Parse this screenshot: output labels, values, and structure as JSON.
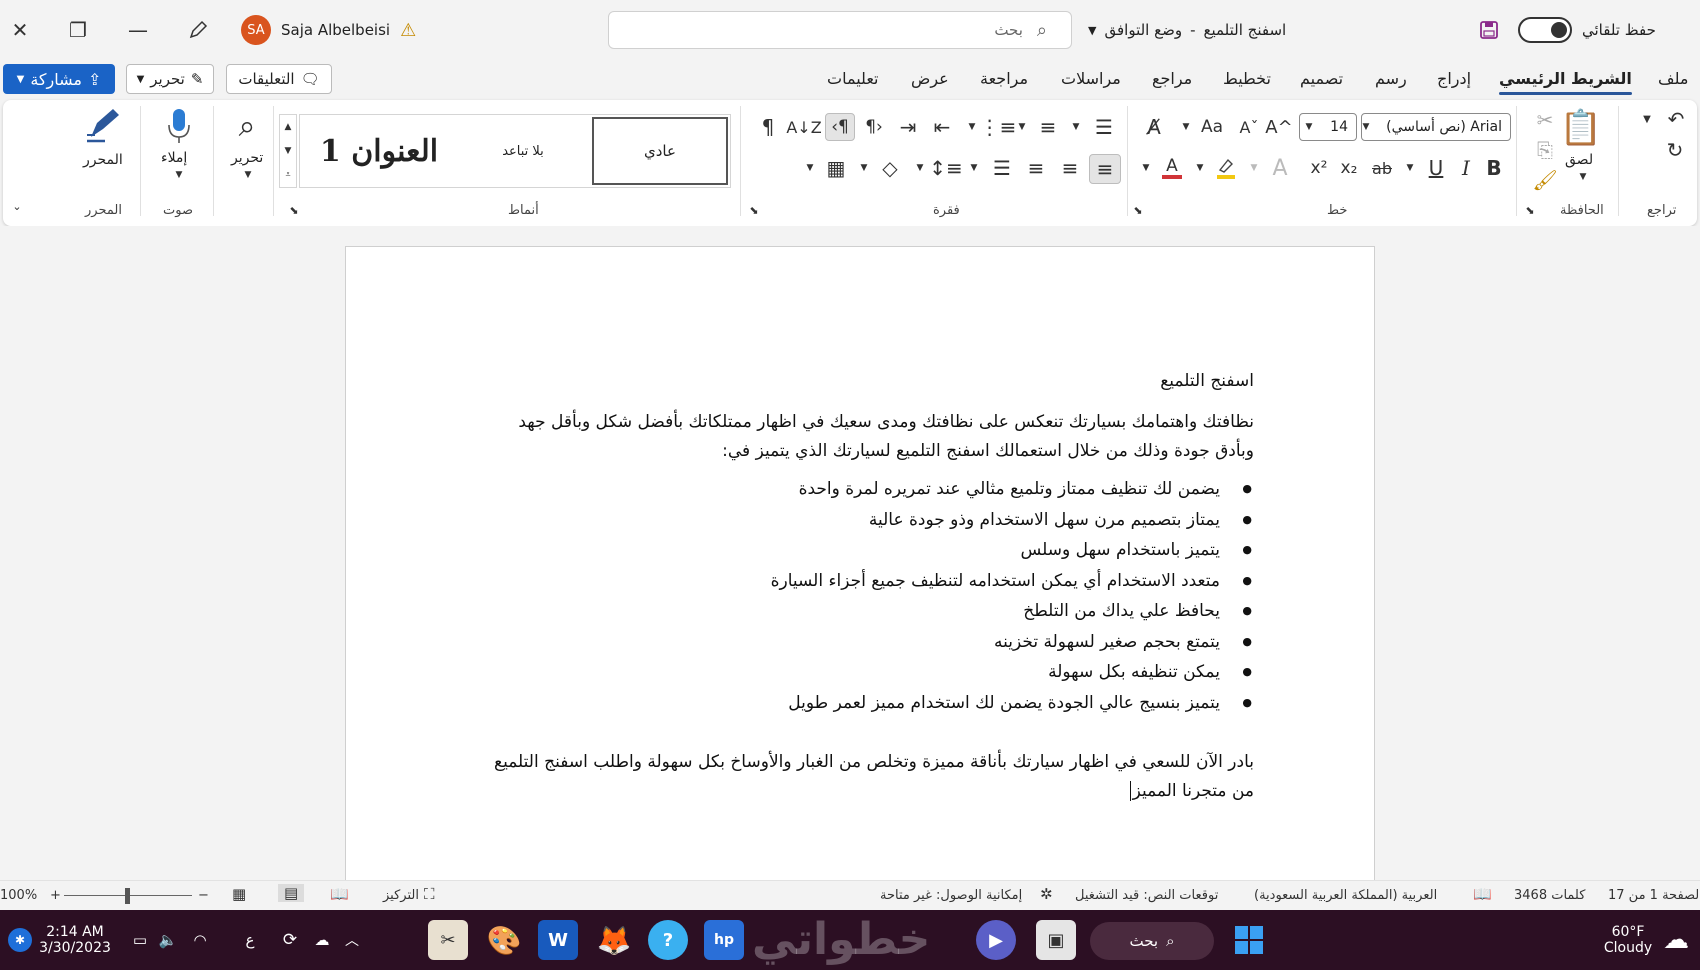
{
  "window": {
    "title": "اسفنج التلميع",
    "mode": "وضع التوافق",
    "title_separator": "-",
    "user_name": "Saja Albelbeisi",
    "user_initials": "SA",
    "autosave_label": "حفظ تلقائي",
    "search_placeholder": "بحث"
  },
  "ribbon_tabs": [
    "ملف",
    "الشريط الرئيسي",
    "إدراج",
    "رسم",
    "تصميم",
    "تخطيط",
    "مراجع",
    "مراسلات",
    "مراجعة",
    "عرض",
    "تعليمات"
  ],
  "ribbon_actions": {
    "comments": "التعليقات",
    "editing": "تحرير",
    "share": "مشاركة"
  },
  "ribbon": {
    "undo_group": "تراجع",
    "clipboard_group": "الحافظة",
    "paste": "لصق",
    "font_group": "خط",
    "font_name": "Arial (نص أساسي)",
    "font_size": "14",
    "bold": "B",
    "italic": "I",
    "underline": "U",
    "strike": "ab",
    "subscript": "x₂",
    "superscript": "x²",
    "text_effects": "A",
    "font_color": "A",
    "grow": "A^",
    "shrink": "Aˇ",
    "change_case": "Aa",
    "paragraph_group": "فقرة",
    "styles_group": "أنماط",
    "style_normal": "عادي",
    "style_no_spacing": "بلا تباعد",
    "style_heading1": "العنوان 1",
    "editing_btn": "تحرير",
    "voice_group": "صوت",
    "dictate": "إملاء",
    "editor_group": "المحرر",
    "editor": "المحرر"
  },
  "document": {
    "title": "اسفنج التلميع",
    "intro": "نظافتك واهتمامك بسيارتك تنعكس على نظافتك ومدى سعيك في اظهار ممتلكاتك بأفضل شكل وبأقل جهد وبأدق جودة وذلك من خلال استعمالك اسفنج التلميع لسيارتك الذي يتميز في:",
    "bullets": [
      "يضمن لك تنظيف ممتاز وتلميع مثالي عند تمريره لمرة واحدة",
      "يمتاز بتصميم مرن سهل الاستخدام وذو جودة عالية",
      "يتميز باستخدام سهل وسلس",
      "متعدد الاستخدام أي يمكن استخدامه لتنظيف جميع أجزاء السيارة",
      "يحافظ علي يداك من التلطخ",
      "يتمتع بحجم صغير لسهولة تخزينه",
      "يمكن تنظيفه بكل سهولة",
      "يتميز بنسيج عالي الجودة يضمن لك استخدام مميز لعمر طويل"
    ],
    "closing": "بادر الآن للسعي في اظهار سيارتك بأناقة مميزة وتخلص من الغبار والأوساخ بكل سهولة واطلب اسفنج التلميع من متجرنا المميز"
  },
  "status": {
    "page": "الصفحة 1 من 17",
    "words": "3468 كلمات",
    "language": "العربية (المملكة العربية السعودية)",
    "predictions": "توقعات النص: قيد التشغيل",
    "accessibility": "إمكانية الوصول: غير متاحة",
    "focus": "التركيز",
    "zoom": "100%",
    "zoom_in": "+",
    "zoom_out": "−"
  },
  "taskbar": {
    "time": "2:14 AM",
    "date": "3/30/2023",
    "input_lang": "ع",
    "search": "بحث",
    "temperature": "60°F",
    "weather": "Cloudy",
    "watermark": "خطواتي"
  },
  "colors": {
    "accent": "#2b579a",
    "share": "#1a63c6",
    "avatar": "#d9541e",
    "taskbar": "#2c0f23",
    "font_color": "#d13438",
    "highlight": "#f2c811"
  }
}
